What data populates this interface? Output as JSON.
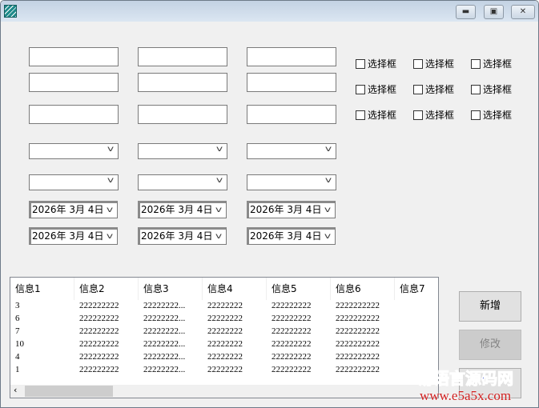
{
  "titlebar": {
    "icon": "app-icon",
    "minimize": "minimize-icon",
    "maximize": "maximize-icon",
    "close": "close-icon"
  },
  "date_value": "2026年 3月 4日",
  "checkbox_label": "选择框",
  "checkboxes": [
    false,
    false,
    false,
    false,
    false,
    false,
    false,
    false,
    false
  ],
  "list": {
    "headers": [
      "信息1",
      "信息2",
      "信息3",
      "信息4",
      "信息5",
      "信息6",
      "信息7"
    ],
    "rows": [
      [
        "3",
        "222222222",
        "22222222...",
        "22222222",
        "222222222",
        "2222222222",
        ""
      ],
      [
        "6",
        "222222222",
        "22222222...",
        "22222222",
        "222222222",
        "2222222222",
        ""
      ],
      [
        "7",
        "222222222",
        "22222222...",
        "22222222",
        "222222222",
        "2222222222",
        ""
      ],
      [
        "10",
        "222222222",
        "22222222...",
        "22222222",
        "222222222",
        "2222222222",
        ""
      ],
      [
        "4",
        "222222222",
        "22222222...",
        "22222222",
        "222222222",
        "2222222222",
        ""
      ],
      [
        "1",
        "222222222",
        "22222222...",
        "22222222",
        "222222222",
        "2222222222",
        ""
      ]
    ]
  },
  "buttons": {
    "add": "新增",
    "edit": "修改"
  },
  "watermark": {
    "line1": "易语言源码网",
    "line2": "www.e5a5x.com"
  }
}
